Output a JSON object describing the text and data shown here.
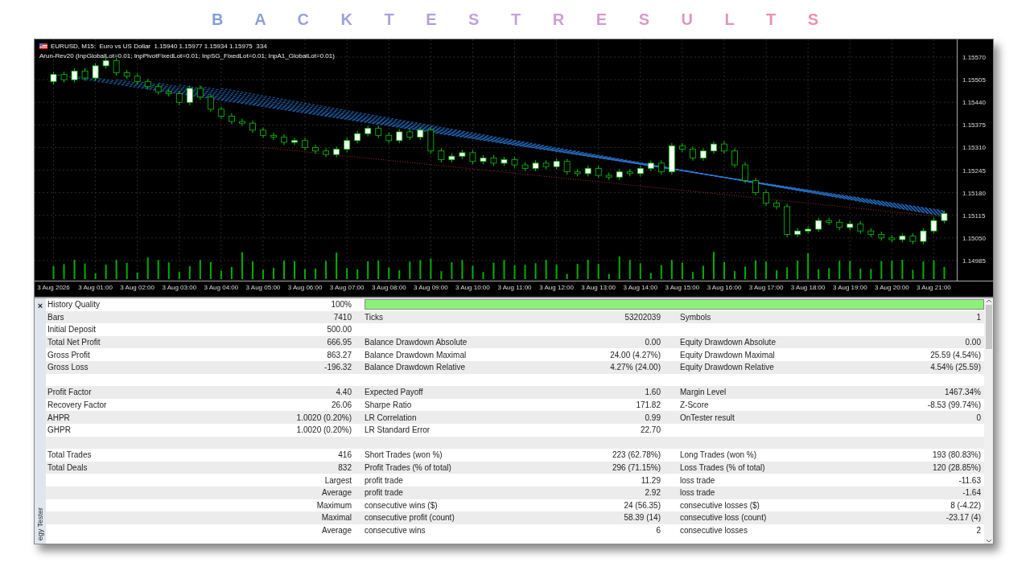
{
  "title": "B A C K T E S T R E S U L T S",
  "chart": {
    "symbol_line": "EURUSD, M15:  Euro vs US Dollar  1.15940 1.15977 1.15934 1.15975  334",
    "indicator_line": "Arun-Rev20 (InpGlobalLot=0.01; InpPivotFixedLot=0.01; InpSG_FixedLot=0.01; InpA1_GlobalLot=0.01)",
    "chart_data": {
      "type": "candlestick",
      "grid": true,
      "ylim": [
        1.14927,
        1.15621
      ],
      "categories": [
        "3 Aug 2026",
        null,
        null,
        null,
        "3 Aug 01:00",
        null,
        null,
        null,
        "3 Aug 02:00",
        null,
        null,
        null,
        "3 Aug 03:00",
        null,
        null,
        null,
        "3 Aug 04:00",
        null,
        null,
        null,
        "3 Aug 05:00",
        null,
        null,
        null,
        "3 Aug 06:00",
        null,
        null,
        null,
        "3 Aug 07:00",
        null,
        null,
        null,
        "3 Aug 08:00",
        null,
        null,
        null,
        "3 Aug 09:00",
        null,
        null,
        null,
        "3 Aug 10:00",
        null,
        null,
        null,
        "3 Aug 11:00",
        null,
        null,
        null,
        "3 Aug 12:00",
        null,
        null,
        null,
        "3 Aug 13:00",
        null,
        null,
        null,
        "3 Aug 14:00",
        null,
        null,
        null,
        "3 Aug 15:00",
        null,
        null,
        null,
        "3 Aug 16:00",
        null,
        null,
        null,
        "3 Aug 17:00",
        null,
        null,
        null,
        "3 Aug 18:00",
        null,
        null,
        null,
        "3 Aug 19:00",
        null,
        null,
        null,
        "3 Aug 20:00",
        null,
        null,
        null,
        "3 Aug 21:00",
        null
      ],
      "yticks": [
        {
          "value": 1.1557,
          "label": "1.15570"
        },
        {
          "value": 1.15505,
          "label": "1.15505"
        },
        {
          "value": 1.1544,
          "label": "1.15440"
        },
        {
          "value": 1.15375,
          "label": "1.15375"
        },
        {
          "value": 1.1531,
          "label": "1.15310"
        },
        {
          "value": 1.15245,
          "label": "1.15245"
        },
        {
          "value": 1.1518,
          "label": "1.15180"
        },
        {
          "value": 1.15115,
          "label": "1.15115"
        },
        {
          "value": 1.1505,
          "label": "1.15050"
        },
        {
          "value": 1.14985,
          "label": "1.14985"
        }
      ],
      "ohlc": [
        [
          1.155,
          1.15528,
          1.15492,
          1.1552
        ],
        [
          1.1552,
          1.15528,
          1.15497,
          1.15505
        ],
        [
          1.15505,
          1.15538,
          1.15497,
          1.1553
        ],
        [
          1.1553,
          1.15538,
          1.15502,
          1.1551
        ],
        [
          1.1551,
          1.15553,
          1.15502,
          1.15545
        ],
        [
          1.15545,
          1.15568,
          1.15537,
          1.1556
        ],
        [
          1.1556,
          1.15568,
          1.15517,
          1.15525
        ],
        [
          1.15525,
          1.15533,
          1.15507,
          1.15515
        ],
        [
          1.15515,
          1.15523,
          1.15492,
          1.155
        ],
        [
          1.155,
          1.15508,
          1.15477,
          1.15485
        ],
        [
          1.15485,
          1.15493,
          1.15462,
          1.1547
        ],
        [
          1.1547,
          1.15478,
          1.15457,
          1.15465
        ],
        [
          1.15465,
          1.15473,
          1.15432,
          1.1544
        ],
        [
          1.1544,
          1.15488,
          1.15432,
          1.1548
        ],
        [
          1.1548,
          1.15488,
          1.15447,
          1.15455
        ],
        [
          1.15455,
          1.15463,
          1.15412,
          1.1542
        ],
        [
          1.1542,
          1.15428,
          1.15392,
          1.154
        ],
        [
          1.154,
          1.15408,
          1.15377,
          1.15385
        ],
        [
          1.15385,
          1.15393,
          1.15372,
          1.1538
        ],
        [
          1.1538,
          1.15388,
          1.15352,
          1.1536
        ],
        [
          1.1536,
          1.15368,
          1.15337,
          1.15345
        ],
        [
          1.15345,
          1.15353,
          1.15332,
          1.1534
        ],
        [
          1.1534,
          1.15348,
          1.15317,
          1.15325
        ],
        [
          1.15325,
          1.15338,
          1.15317,
          1.1533
        ],
        [
          1.1533,
          1.15338,
          1.15302,
          1.1531
        ],
        [
          1.1531,
          1.15318,
          1.15292,
          1.153
        ],
        [
          1.153,
          1.15308,
          1.15282,
          1.1529
        ],
        [
          1.1529,
          1.15313,
          1.15282,
          1.15305
        ],
        [
          1.15305,
          1.15338,
          1.15297,
          1.1533
        ],
        [
          1.1533,
          1.15358,
          1.15322,
          1.1535
        ],
        [
          1.1535,
          1.15373,
          1.15342,
          1.15365
        ],
        [
          1.15365,
          1.15373,
          1.15337,
          1.15345
        ],
        [
          1.15345,
          1.15353,
          1.15322,
          1.1533
        ],
        [
          1.1533,
          1.15363,
          1.15322,
          1.15355
        ],
        [
          1.15355,
          1.15363,
          1.15332,
          1.1534
        ],
        [
          1.1534,
          1.15368,
          1.15332,
          1.1536
        ],
        [
          1.1536,
          1.15368,
          1.15292,
          1.153
        ],
        [
          1.153,
          1.15308,
          1.15267,
          1.15275
        ],
        [
          1.15275,
          1.15293,
          1.15267,
          1.15285
        ],
        [
          1.15285,
          1.15303,
          1.15277,
          1.15295
        ],
        [
          1.15295,
          1.15303,
          1.15262,
          1.1527
        ],
        [
          1.1527,
          1.15288,
          1.15262,
          1.1528
        ],
        [
          1.1528,
          1.15288,
          1.15257,
          1.15265
        ],
        [
          1.15265,
          1.15283,
          1.15257,
          1.15275
        ],
        [
          1.15275,
          1.15283,
          1.15252,
          1.1526
        ],
        [
          1.1526,
          1.15268,
          1.15242,
          1.1525
        ],
        [
          1.1525,
          1.15273,
          1.15242,
          1.15265
        ],
        [
          1.15265,
          1.15273,
          1.15247,
          1.15255
        ],
        [
          1.15255,
          1.15278,
          1.15247,
          1.1527
        ],
        [
          1.1527,
          1.15278,
          1.15232,
          1.1524
        ],
        [
          1.1524,
          1.15248,
          1.15227,
          1.15235
        ],
        [
          1.15235,
          1.15258,
          1.15227,
          1.1525
        ],
        [
          1.1525,
          1.15258,
          1.15222,
          1.1523
        ],
        [
          1.1523,
          1.15238,
          1.15217,
          1.15225
        ],
        [
          1.15225,
          1.15248,
          1.15217,
          1.1524
        ],
        [
          1.1524,
          1.15248,
          1.15227,
          1.15235
        ],
        [
          1.15235,
          1.15258,
          1.15227,
          1.1525
        ],
        [
          1.1525,
          1.15273,
          1.15242,
          1.15265
        ],
        [
          1.15265,
          1.15273,
          1.15232,
          1.1524
        ],
        [
          1.1524,
          1.15323,
          1.15232,
          1.15315
        ],
        [
          1.15315,
          1.15323,
          1.15297,
          1.15305
        ],
        [
          1.15305,
          1.15313,
          1.15272,
          1.1528
        ],
        [
          1.1528,
          1.15308,
          1.15272,
          1.153
        ],
        [
          1.153,
          1.15328,
          1.15292,
          1.1532
        ],
        [
          1.1532,
          1.15328,
          1.15292,
          1.153
        ],
        [
          1.153,
          1.15308,
          1.15252,
          1.1526
        ],
        [
          1.1526,
          1.15268,
          1.15207,
          1.15215
        ],
        [
          1.15215,
          1.15223,
          1.15172,
          1.1518
        ],
        [
          1.1518,
          1.15188,
          1.15142,
          1.1515
        ],
        [
          1.1515,
          1.15158,
          1.15132,
          1.1514
        ],
        [
          1.1514,
          1.15148,
          1.15052,
          1.1506
        ],
        [
          1.1506,
          1.15078,
          1.15052,
          1.1507
        ],
        [
          1.1507,
          1.15083,
          1.15062,
          1.15075
        ],
        [
          1.15075,
          1.15108,
          1.15067,
          1.151
        ],
        [
          1.151,
          1.15108,
          1.15087,
          1.15095
        ],
        [
          1.15095,
          1.15103,
          1.15072,
          1.1508
        ],
        [
          1.1508,
          1.15098,
          1.15072,
          1.1509
        ],
        [
          1.1509,
          1.15098,
          1.15062,
          1.1507
        ],
        [
          1.1507,
          1.15078,
          1.15052,
          1.1506
        ],
        [
          1.1506,
          1.15068,
          1.15042,
          1.1505
        ],
        [
          1.1505,
          1.15058,
          1.15037,
          1.15045
        ],
        [
          1.15045,
          1.15063,
          1.15037,
          1.15055
        ],
        [
          1.15055,
          1.15063,
          1.15032,
          1.1504
        ],
        [
          1.1504,
          1.15078,
          1.15032,
          1.1507
        ],
        [
          1.1507,
          1.15108,
          1.15062,
          1.151
        ],
        [
          1.151,
          1.15128,
          1.15092,
          1.1512
        ]
      ]
    }
  },
  "tester": {
    "close_glyph": "×",
    "side_label": "egy Tester",
    "rows": [
      {
        "kind": "quality",
        "l1": "History Quality",
        "v1": "100%",
        "level": 1
      },
      {
        "kind": "stats",
        "l1": "Bars",
        "v1": "7410",
        "l2": "Ticks",
        "v2": "53202039",
        "l3": "Symbols",
        "v3": "1"
      },
      {
        "kind": "stats",
        "l1": "Initial Deposit",
        "v1": "500.00"
      },
      {
        "kind": "stats",
        "l1": "Total Net Profit",
        "v1": "666.95",
        "l2": "Balance Drawdown Absolute",
        "v2": "0.00",
        "l3": "Equity Drawdown Absolute",
        "v3": "0.00"
      },
      {
        "kind": "stats",
        "l1": "Gross Profit",
        "v1": "863.27",
        "l2": "Balance Drawdown Maximal",
        "v2": "24.00 (4.27%)",
        "l3": "Equity Drawdown Maximal",
        "v3": "25.59 (4.54%)"
      },
      {
        "kind": "stats",
        "l1": "Gross Loss",
        "v1": "-196.32",
        "l2": "Balance Drawdown Relative",
        "v2": "4.27% (24.00)",
        "l3": "Equity Drawdown Relative",
        "v3": "4.54% (25.59)"
      },
      {
        "kind": "spacer"
      },
      {
        "kind": "stats",
        "l1": "Profit Factor",
        "v1": "4.40",
        "l2": "Expected Payoff",
        "v2": "1.60",
        "l3": "Margin Level",
        "v3": "1467.34%"
      },
      {
        "kind": "stats",
        "l1": "Recovery Factor",
        "v1": "26.06",
        "l2": "Sharpe Ratio",
        "v2": "171.82",
        "l3": "Z-Score",
        "v3": "-8.53 (99.74%)"
      },
      {
        "kind": "stats",
        "l1": "AHPR",
        "v1": "1.0020 (0.20%)",
        "l2": "LR Correlation",
        "v2": "0.99",
        "l3": "OnTester result",
        "v3": "0"
      },
      {
        "kind": "stats",
        "l1": "GHPR",
        "v1": "1.0020 (0.20%)",
        "l2": "LR Standard Error",
        "v2": "22.70"
      },
      {
        "kind": "spacer"
      },
      {
        "kind": "stats",
        "l1": "Total Trades",
        "v1": "416",
        "l2": "Short Trades (won %)",
        "v2": "223 (62.78%)",
        "l3": "Long Trades (won %)",
        "v3": "193 (80.83%)"
      },
      {
        "kind": "stats",
        "l1": "Total Deals",
        "v1": "832",
        "l2": "Profit Trades (% of total)",
        "v2": "296 (71.15%)",
        "l3": "Loss Trades (% of total)",
        "v3": "120 (28.85%)"
      },
      {
        "kind": "stats",
        "v1": "Largest",
        "l2": "profit trade",
        "v2": "11.29",
        "l3": "loss trade",
        "v3": "-11.63"
      },
      {
        "kind": "stats",
        "v1": "Average",
        "l2": "profit trade",
        "v2": "2.92",
        "l3": "loss trade",
        "v3": "-1.64"
      },
      {
        "kind": "stats",
        "v1": "Maximum",
        "l2": "consecutive wins ($)",
        "v2": "24 (56.35)",
        "l3": "consecutive losses ($)",
        "v3": "8 (-4.22)"
      },
      {
        "kind": "stats",
        "v1": "Maximal",
        "l2": "consecutive profit (count)",
        "v2": "58.39 (14)",
        "l3": "consecutive loss (count)",
        "v3": "-23.17 (4)"
      },
      {
        "kind": "stats",
        "v1": "Average",
        "l2": "consecutive wins",
        "v2": "6",
        "l3": "consecutive losses",
        "v3": "2"
      }
    ]
  }
}
